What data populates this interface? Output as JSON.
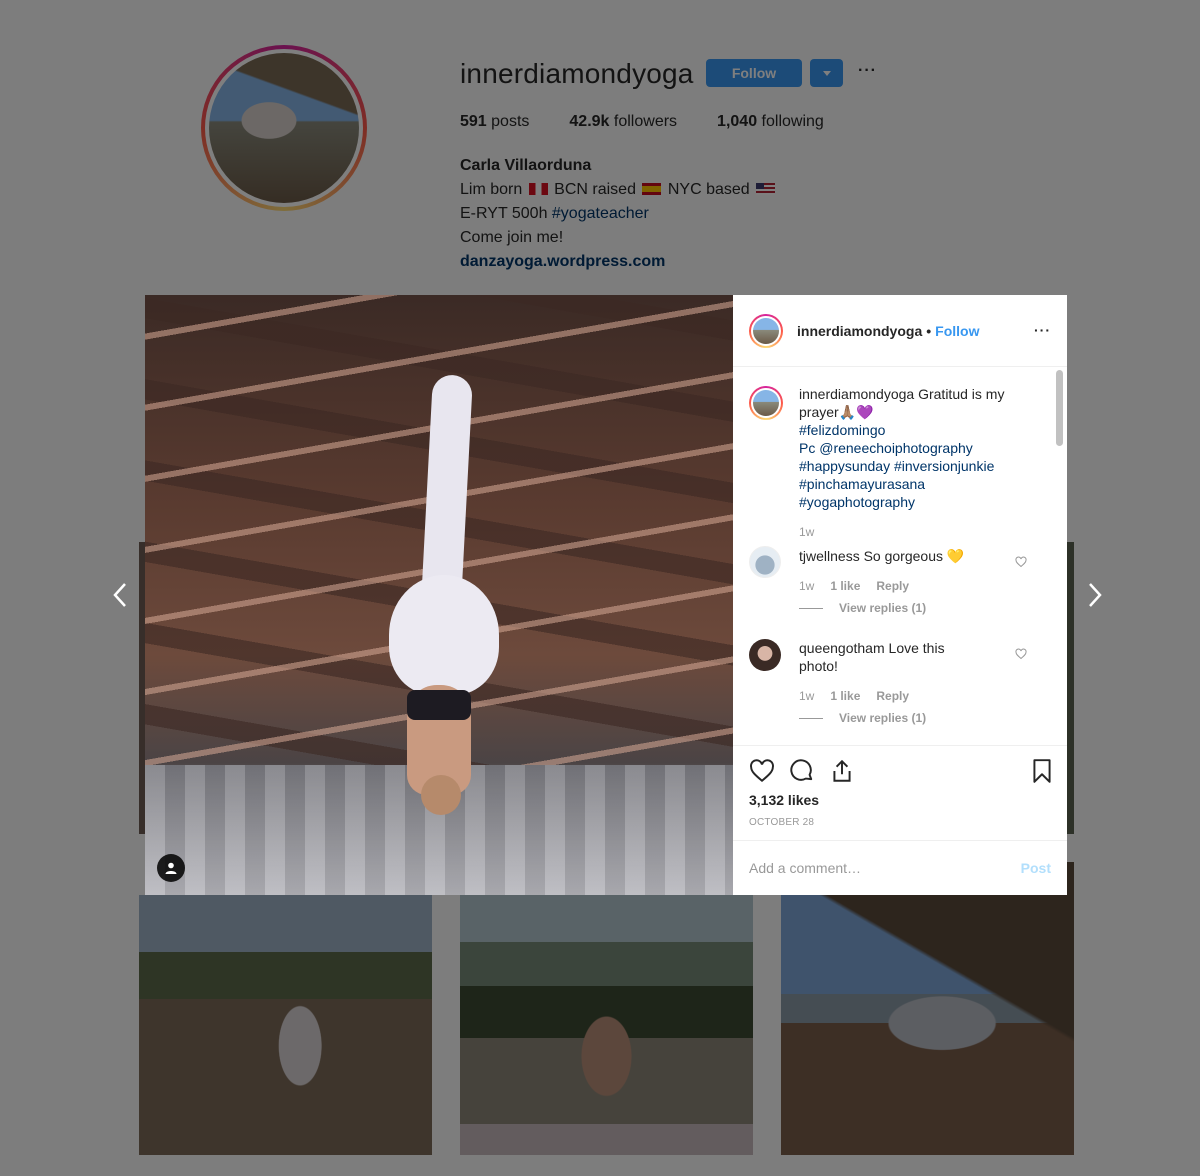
{
  "profile": {
    "username": "innerdiamondyoga",
    "follow_label": "Follow",
    "more_label": "···",
    "stats": {
      "posts_count": "591",
      "posts_label": "posts",
      "followers_count": "42.9k",
      "followers_label": "followers",
      "following_count": "1,040",
      "following_label": "following"
    },
    "bio": {
      "name": "Carla Villaorduna",
      "line1_a": "Lim born",
      "line1_b": "BCN raised",
      "line1_c": "NYC based",
      "line2_text": "E-RYT 500h ",
      "line2_tag": "#yogateacher",
      "line3": "Come join me!",
      "link": "danzayoga.wordpress.com"
    }
  },
  "post": {
    "header": {
      "username": "innerdiamondyoga",
      "dot": "•",
      "follow_label": "Follow",
      "more_label": "···"
    },
    "caption": {
      "username": "innerdiamondyoga",
      "text": "Gratitud is my prayer🙏🏽💜",
      "tag1": "#felizdomingo",
      "line_pc": "Pc @reneechoiphotography",
      "tag2": "#happysunday #inversionjunkie",
      "tag3": "#pinchamayurasana",
      "tag4": "#yogaphotography",
      "time": "1w"
    },
    "comments": [
      {
        "username": "tjwellness",
        "text": "So gorgeous 💛",
        "time": "1w",
        "likes": "1 like",
        "reply_label": "Reply",
        "view_replies": "View replies (1)"
      },
      {
        "username": "queengotham",
        "text": "Love this photo!",
        "time": "1w",
        "likes": "1 like",
        "reply_label": "Reply",
        "view_replies": "View replies (1)"
      }
    ],
    "likes": "3,132 likes",
    "date": "OCTOBER 28",
    "comment_placeholder": "Add a comment…",
    "post_label": "Post"
  },
  "icons": {
    "heart": "heart-icon",
    "comment": "comment-icon",
    "share": "share-icon",
    "bookmark": "bookmark-icon",
    "user_tag": "user-tag-icon",
    "nav_prev": "chevron-left-icon",
    "nav_next": "chevron-right-icon"
  },
  "colors": {
    "accent": "#3897f0",
    "hashtag": "#003569",
    "muted": "#999999",
    "overlay": "rgba(0,0,0,0.5)"
  }
}
